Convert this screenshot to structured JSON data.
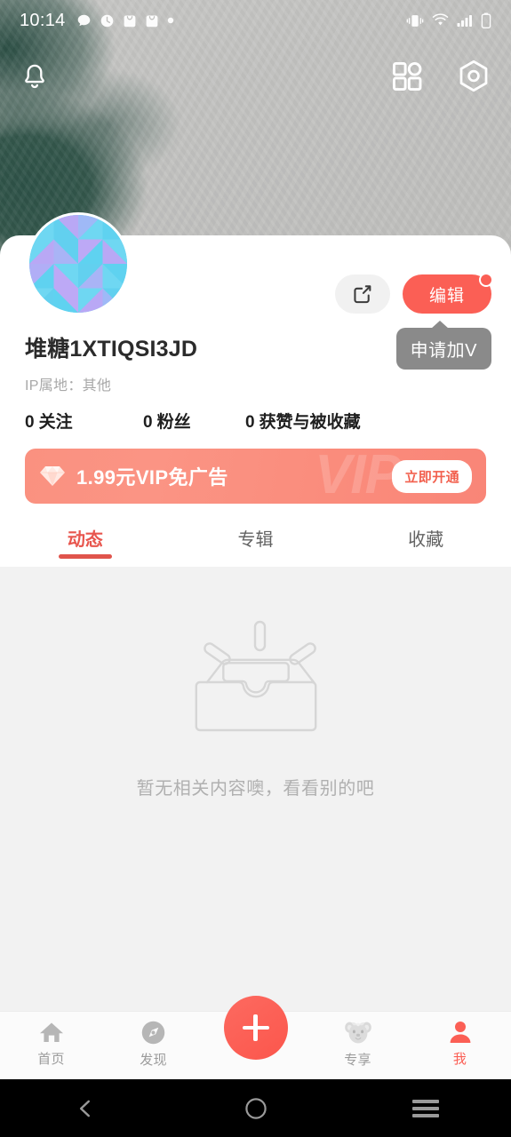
{
  "status_bar": {
    "time": "10:14",
    "left_icons": [
      "chat-bubble-icon",
      "clock-icon",
      "bag-icon",
      "bag-icon",
      "dot-icon"
    ],
    "right_icons": [
      "vibrate-icon",
      "wifi-icon",
      "signal-icon",
      "battery-icon"
    ]
  },
  "top_bar": {
    "notification_icon": "bell-icon",
    "grid_icon": "grid-icon",
    "settings_icon": "hexagon-settings-icon"
  },
  "profile": {
    "avatar": "geometric-triangles-avatar",
    "username": "堆糖1XTIQSI3JD",
    "ip_location": "IP属地：其他",
    "share_icon": "share-icon",
    "edit_label": "编辑",
    "has_edit_badge": true,
    "verify_tooltip": "申请加V",
    "stats": [
      {
        "count": "0",
        "label": "关注"
      },
      {
        "count": "0",
        "label": "粉丝"
      },
      {
        "count": "0",
        "label": "获赞与被收藏"
      }
    ]
  },
  "vip_banner": {
    "gem_icon": "diamond-icon",
    "text": "1.99元VIP免广告",
    "cta": "立即开通",
    "watermark": "VIP",
    "accent": "#fa8d7d"
  },
  "tabs": [
    {
      "label": "动态",
      "active": true
    },
    {
      "label": "专辑",
      "active": false
    },
    {
      "label": "收藏",
      "active": false
    }
  ],
  "empty_state": {
    "illustration": "empty-box-icon",
    "message": "暂无相关内容噢，看看别的吧"
  },
  "bottom_nav": {
    "items": [
      {
        "label": "首页",
        "icon": "home-icon",
        "active": false
      },
      {
        "label": "发现",
        "icon": "compass-icon",
        "active": false
      },
      {
        "label": "",
        "icon": "plus-fab-icon",
        "active": false
      },
      {
        "label": "专享",
        "icon": "bear-icon",
        "active": false
      },
      {
        "label": "我",
        "icon": "person-icon",
        "active": true
      }
    ],
    "active_color": "#fb5f55"
  },
  "android_nav": {
    "back": "back-chevron-icon",
    "home": "home-circle-icon",
    "recents": "recents-icon"
  }
}
